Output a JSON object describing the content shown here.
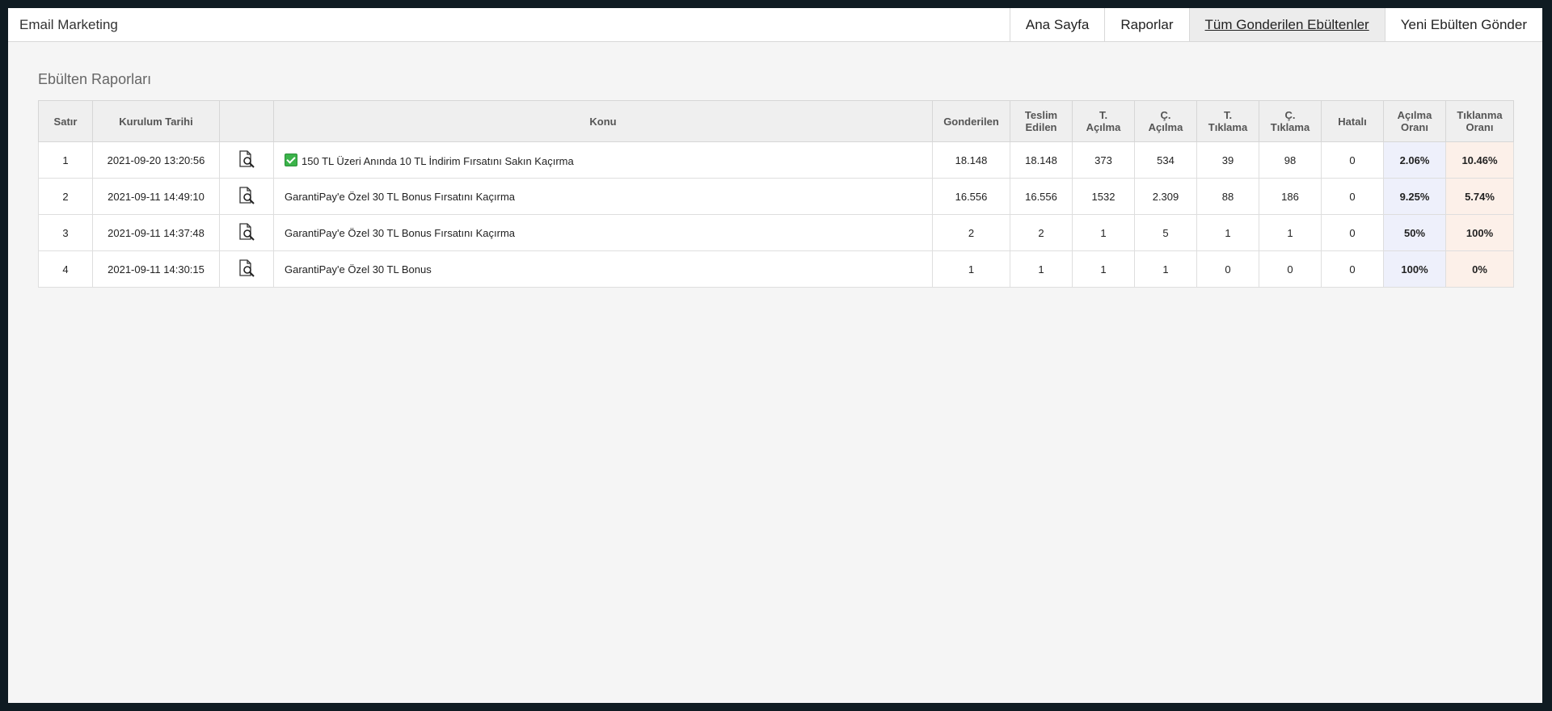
{
  "app": {
    "title": "Email Marketing"
  },
  "nav": {
    "items": [
      {
        "label": "Ana Sayfa",
        "active": false
      },
      {
        "label": "Raporlar",
        "active": false
      },
      {
        "label": "Tüm Gonderilen Ebültenler",
        "active": true
      },
      {
        "label": "Yeni Ebülten Gönder",
        "active": false
      }
    ]
  },
  "page": {
    "title": "Ebülten Raporları"
  },
  "table": {
    "headers": {
      "row": "Satır",
      "date": "Kurulum Tarihi",
      "preview": "",
      "subject": "Konu",
      "sent": "Gonderilen",
      "delivered_1": "Teslim",
      "delivered_2": "Edilen",
      "t_open_1": "T.",
      "t_open_2": "Açılma",
      "c_open_1": "Ç.",
      "c_open_2": "Açılma",
      "t_click_1": "T.",
      "t_click_2": "Tıklama",
      "c_click_1": "Ç.",
      "c_click_2": "Tıklama",
      "errors": "Hatalı",
      "open_rate_1": "Açılma",
      "open_rate_2": "Oranı",
      "click_rate_1": "Tıklanma",
      "click_rate_2": "Oranı"
    },
    "rows": [
      {
        "row": "1",
        "date": "2021-09-20 13:20:56",
        "icon": "preview-search-icon",
        "has_check": true,
        "subject": "150 TL Üzeri Anında 10 TL İndirim Fırsatını Sakın Kaçırma",
        "sent": "18.148",
        "delivered": "18.148",
        "t_open": "373",
        "c_open": "534",
        "t_click": "39",
        "c_click": "98",
        "errors": "0",
        "open_rate": "2.06%",
        "click_rate": "10.46%"
      },
      {
        "row": "2",
        "date": "2021-09-11 14:49:10",
        "icon": "preview-search-icon",
        "has_check": false,
        "subject": "GarantiPay'e Özel 30 TL Bonus Fırsatını Kaçırma",
        "sent": "16.556",
        "delivered": "16.556",
        "t_open": "1532",
        "c_open": "2.309",
        "t_click": "88",
        "c_click": "186",
        "errors": "0",
        "open_rate": "9.25%",
        "click_rate": "5.74%"
      },
      {
        "row": "3",
        "date": "2021-09-11 14:37:48",
        "icon": "preview-search-icon",
        "has_check": false,
        "subject": "GarantiPay'e Özel 30 TL Bonus Fırsatını Kaçırma",
        "sent": "2",
        "delivered": "2",
        "t_open": "1",
        "c_open": "5",
        "t_click": "1",
        "c_click": "1",
        "errors": "0",
        "open_rate": "50%",
        "click_rate": "100%"
      },
      {
        "row": "4",
        "date": "2021-09-11 14:30:15",
        "icon": "preview-search-icon",
        "has_check": false,
        "subject": "GarantiPay'e Özel 30 TL Bonus",
        "sent": "1",
        "delivered": "1",
        "t_open": "1",
        "c_open": "1",
        "t_click": "0",
        "c_click": "0",
        "errors": "0",
        "open_rate": "100%",
        "click_rate": "0%"
      }
    ]
  },
  "colors": {
    "open_rate_bg": "#eef0fb",
    "click_rate_bg": "#fcf0e9",
    "check_green": "#3bb34a",
    "outer_frame": "#0f1b22"
  }
}
